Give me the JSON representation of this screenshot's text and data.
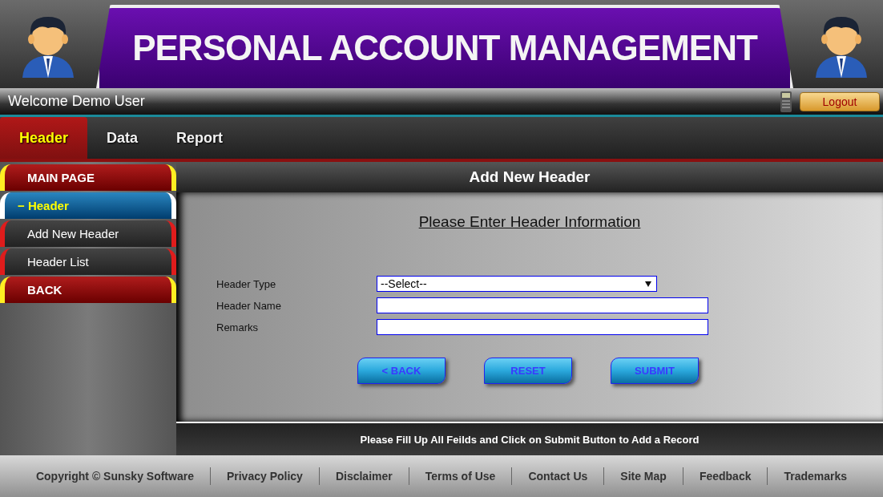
{
  "banner": {
    "title": "PERSONAL ACCOUNT MANAGEMENT"
  },
  "user_bar": {
    "welcome": "Welcome Demo User",
    "logout": "Logout"
  },
  "tabs": [
    {
      "label": "Header",
      "selected": true
    },
    {
      "label": "Data",
      "selected": false
    },
    {
      "label": "Report",
      "selected": false
    }
  ],
  "sidebar": {
    "items": [
      {
        "label": "MAIN PAGE",
        "kind": "section"
      },
      {
        "label": "− Header",
        "kind": "open"
      },
      {
        "label": "Add New Header",
        "kind": "sub"
      },
      {
        "label": "Header List",
        "kind": "sub"
      },
      {
        "label": "BACK",
        "kind": "section"
      }
    ]
  },
  "panel": {
    "title": "Add New Header",
    "heading": "Please Enter Header Information",
    "fields": [
      {
        "label": "Header Type",
        "kind": "select",
        "value": "--Select--"
      },
      {
        "label": "Header Name",
        "kind": "text"
      },
      {
        "label": "Remarks",
        "kind": "text"
      }
    ],
    "buttons": [
      "< BACK",
      "RESET",
      "SUBMIT"
    ],
    "note": "Please Fill Up All Feilds and Click on Submit Button to Add a Record"
  },
  "footer": {
    "links": [
      "Copyright © Sunsky Software",
      "Privacy Policy",
      "Disclaimer",
      "Terms of Use",
      "Contact Us",
      "Site Map",
      "Feedback",
      "Trademarks"
    ]
  }
}
